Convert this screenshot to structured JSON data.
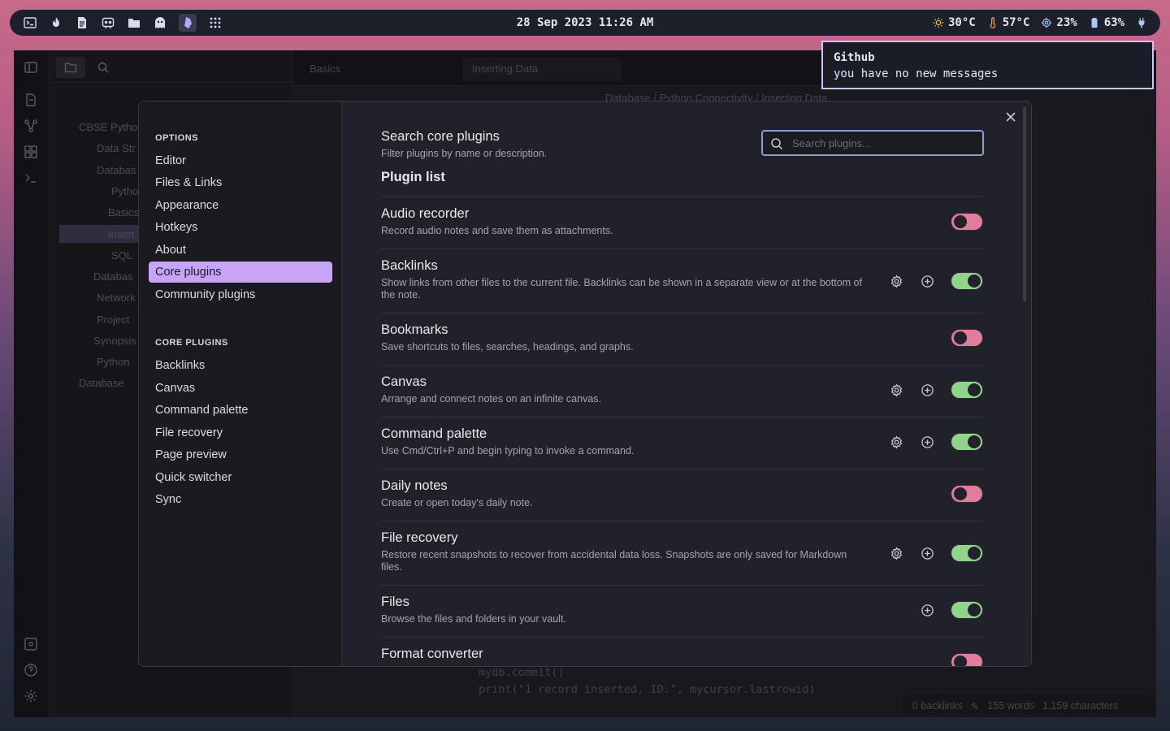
{
  "topbar": {
    "launcher_icons": [
      "terminal-icon",
      "flame-icon",
      "document-icon",
      "discord-icon",
      "folder-icon",
      "ghost-icon",
      "obsidian-icon",
      "apps-grid-icon"
    ],
    "clock": "28 Sep 2023 11:26 AM",
    "stats": {
      "temperature": "30°C",
      "cpu_temp": "57°C",
      "cpu": "23%",
      "battery": "63%"
    }
  },
  "notification": {
    "title": "Github",
    "body": "you have no new messages"
  },
  "background_app": {
    "tabs": [
      "Basics",
      "Inserting Data"
    ],
    "breadcrumb": "Database  /  Python Connectivity  /  Inserting Data",
    "tree": [
      "CBSE Pytho",
      "Data Str",
      "Databas",
      "Pytho",
      "Basics",
      "Insert",
      "SQL",
      "Databas",
      "Network",
      "Project",
      "Synopsis",
      "Python",
      "Database"
    ],
    "code": [
      "mydb.commit()",
      "print(\"1 record inserted, ID:\", mycursor.lastrowid)"
    ],
    "status": {
      "backlinks": "0 backlinks",
      "words": "155 words",
      "characters": "1,159 characters"
    }
  },
  "settings": {
    "options_heading": "OPTIONS",
    "options": [
      "Editor",
      "Files & Links",
      "Appearance",
      "Hotkeys",
      "About",
      "Core plugins",
      "Community plugins"
    ],
    "active_option": "Core plugins",
    "core_plugins_heading": "CORE PLUGINS",
    "core_plugin_links": [
      "Backlinks",
      "Canvas",
      "Command palette",
      "File recovery",
      "Page preview",
      "Quick switcher",
      "Sync"
    ],
    "search": {
      "title": "Search core plugins",
      "description": "Filter plugins by name or description.",
      "placeholder": "Search plugins..."
    },
    "plugin_list_heading": "Plugin list",
    "plugins": [
      {
        "name": "Audio recorder",
        "description": "Record audio notes and save them as attachments.",
        "enabled": false,
        "settings": false,
        "add": false
      },
      {
        "name": "Backlinks",
        "description": "Show links from other files to the current file. Backlinks can be shown in a separate view or at the bottom of the note.",
        "enabled": true,
        "settings": true,
        "add": true
      },
      {
        "name": "Bookmarks",
        "description": "Save shortcuts to files, searches, headings, and graphs.",
        "enabled": false,
        "settings": false,
        "add": false
      },
      {
        "name": "Canvas",
        "description": "Arrange and connect notes on an infinite canvas.",
        "enabled": true,
        "settings": true,
        "add": true
      },
      {
        "name": "Command palette",
        "description": "Use Cmd/Ctrl+P and begin typing to invoke a command.",
        "enabled": true,
        "settings": true,
        "add": true
      },
      {
        "name": "Daily notes",
        "description": "Create or open today's daily note.",
        "enabled": false,
        "settings": false,
        "add": false
      },
      {
        "name": "File recovery",
        "description": "Restore recent snapshots to recover from accidental data loss. Snapshots are only saved for Markdown files.",
        "enabled": true,
        "settings": true,
        "add": true
      },
      {
        "name": "Files",
        "description": "Browse the files and folders in your vault.",
        "enabled": true,
        "settings": false,
        "add": true
      },
      {
        "name": "Format converter",
        "description": "",
        "enabled": false,
        "settings": false,
        "add": false
      }
    ]
  },
  "colors": {
    "accent": "#c8a4f7",
    "toggle_on": "#8fd48a",
    "toggle_off": "#e17c9a",
    "notification_border": "#c9c6f8"
  }
}
